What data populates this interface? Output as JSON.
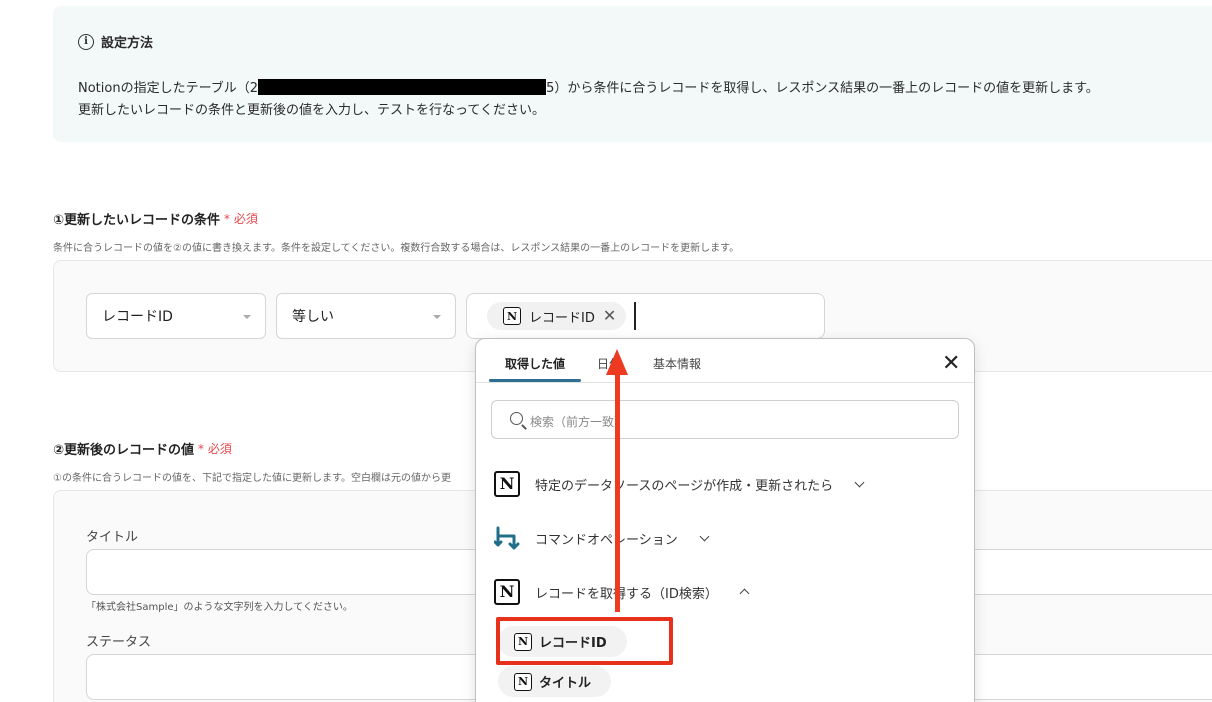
{
  "info": {
    "title": "設定方法",
    "line1_a": "Notionの指定したテーブル（2",
    "line1_b": "5）から条件に合うレコードを取得し、レスポンス結果の一番上のレコードの値を更新します。",
    "line2": "更新したいレコードの条件と更新後の値を入力し、テストを行なってください。"
  },
  "section1": {
    "title": "①更新したいレコードの条件",
    "required": "必須",
    "description": "条件に合うレコードの値を②の値に書き換えます。条件を設定してください。複数行合致する場合は、レスポンス結果の一番上のレコードを更新します。",
    "field_select": "レコードID",
    "operator_select": "等しい",
    "value_chip": "レコードID"
  },
  "section2": {
    "title": "②更新後のレコードの値",
    "required": "必須",
    "description": "①の条件に合うレコードの値を、下記で指定した値に更新します。空白欄は元の値から更",
    "fields": [
      {
        "label": "タイトル",
        "hint": "「株式会社Sample」のような文字列を入力してください。"
      },
      {
        "label": "ステータス"
      }
    ]
  },
  "popup": {
    "tabs": [
      "取得した値",
      "日付",
      "基本情報"
    ],
    "active_tab": "取得した値",
    "search_placeholder": "検索（前方一致）",
    "groups": [
      {
        "label": "特定のデータソースのページが作成・更新されたら",
        "icon": "notion-icon",
        "expanded": false
      },
      {
        "label": "コマンドオペレーション",
        "icon": "command-operation-icon",
        "expanded": false
      },
      {
        "label": "レコードを取得する（ID検索）",
        "icon": "notion-icon",
        "expanded": true
      }
    ],
    "items": [
      "レコードID",
      "タイトル"
    ]
  },
  "colors": {
    "annotation": "#e8311a",
    "tab_underline": "#2e6e8e",
    "required": "#e5484d",
    "command_icon": "#1f6f8b"
  }
}
